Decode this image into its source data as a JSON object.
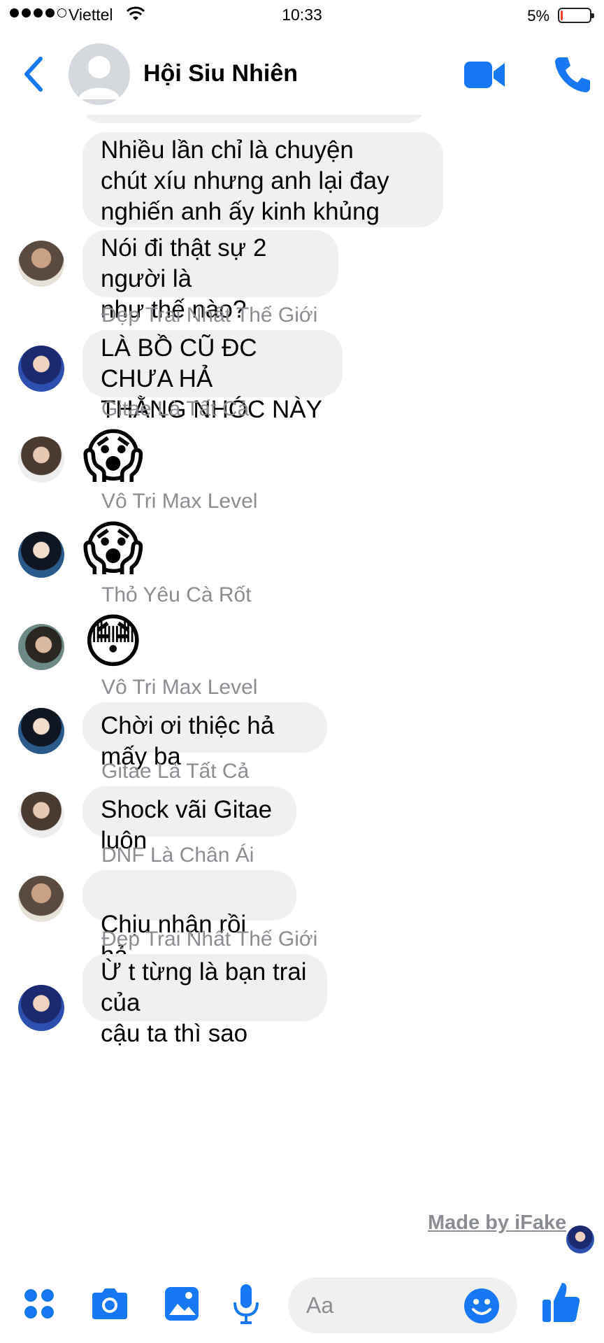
{
  "status_bar": {
    "carrier": "Viettel",
    "time": "10:33",
    "battery": "5%",
    "battery_level": 0.05
  },
  "header": {
    "title": "Hội Siu Nhiên"
  },
  "messages": [
    {
      "text": "Nhiều lần chỉ là chuyện\nchút xíu nhưng anh lại đay\nnghiến anh ấy kinh khủng"
    },
    {
      "text": "Nói đi thật sự 2 người là\nnhư thế nào?"
    },
    {
      "sender": "Đẹp Trai Nhất Thế Giới",
      "text": "LÀ BỒ CŨ ĐC CHƯA HẢ\nTHẰNG NHÓC NÀY"
    },
    {
      "sender": "Gitae Là Tất Cả",
      "emoji": "😱"
    },
    {
      "sender": "Vô Tri Max Level",
      "emoji": "😱"
    },
    {
      "sender": "Thỏ Yêu Cà Rốt",
      "emoji": "😳"
    },
    {
      "sender": "Vô Tri Max Level",
      "text": "Chời ơi thiệc hả mấy ba"
    },
    {
      "sender": "Gitae Là Tất Cả",
      "text": "Shock vãi Gitae luôn"
    },
    {
      "sender": "DNF Là Chân Ái",
      "text": "Chịu nhận rồi hả",
      "emoji": "😏"
    },
    {
      "sender": "Đẹp Trai Nhất Thế Giới",
      "text": "Ừ t từng là bạn trai của\ncậu ta thì sao"
    }
  ],
  "watermark": "Made by iFake",
  "composer": {
    "placeholder": "Aa"
  },
  "colors": {
    "accent": "#1877f2",
    "bubble": "#f1f0f0",
    "sender_gray": "#8a8d91"
  }
}
